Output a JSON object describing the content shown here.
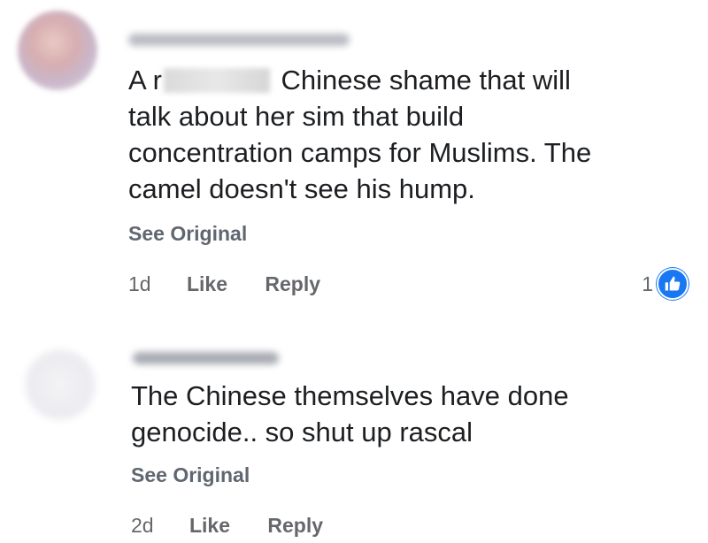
{
  "comments": [
    {
      "body_prefix": "A r",
      "body_after_redaction": " Chinese shame that will",
      "body_lines": [
        "talk about her sim that build",
        "concentration camps for Muslims. The",
        "camel doesn't see his hump."
      ],
      "see_original": "See Original",
      "time": "1d",
      "like_label": "Like",
      "reply_label": "Reply",
      "reaction_count": "1",
      "reaction_icon": "like-icon"
    },
    {
      "body_lines": [
        "The Chinese themselves have done",
        "genocide.. so shut up rascal"
      ],
      "see_original": "See Original",
      "time": "2d",
      "like_label": "Like",
      "reply_label": "Reply"
    }
  ],
  "colors": {
    "text": "#1c1e21",
    "secondary": "#65676b",
    "like_blue": "#1877f2"
  }
}
